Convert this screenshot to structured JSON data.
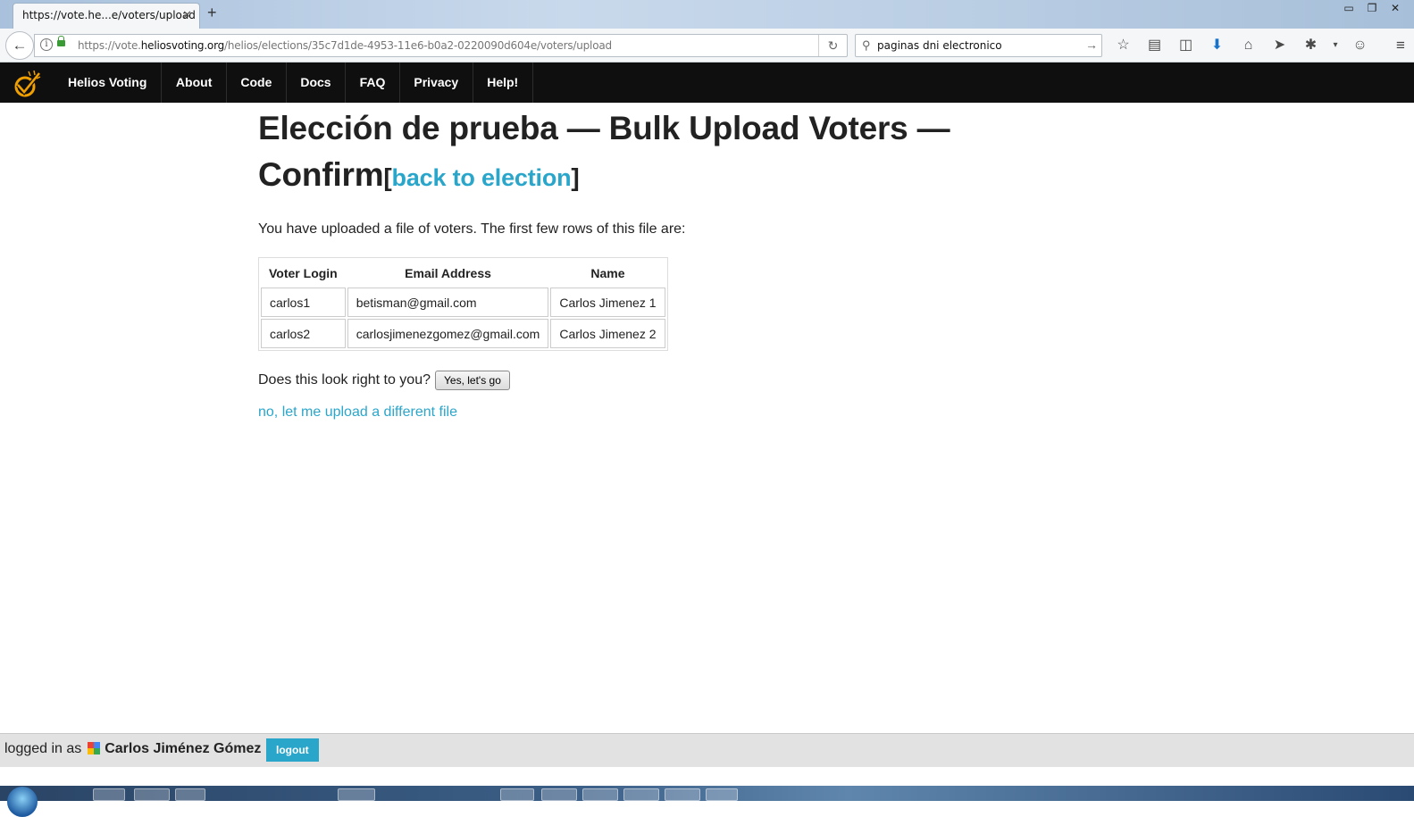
{
  "browser": {
    "tab_title": "https://vote.he...e/voters/upload",
    "tab_close": "✕",
    "new_tab": "+",
    "url_prefix": "https://vote.",
    "url_domain": "heliosvoting.org",
    "url_path": "/helios/elections/35c7d1de-4953-11e6-b0a2-0220090d604e/voters/upload",
    "search_value": "paginas dni electronico",
    "window_buttons": [
      "▭",
      "❐",
      "✕"
    ]
  },
  "nav": {
    "brand": "Helios Voting",
    "items": [
      "About",
      "Code",
      "Docs",
      "FAQ",
      "Privacy",
      "Help!"
    ]
  },
  "page": {
    "title": "Elección de prueba — Bulk Upload Voters — Confirm",
    "back_link_open": "[",
    "back_link": "back to election",
    "back_link_close": "]",
    "intro": "You have uploaded a file of voters. The first few rows of this file are:",
    "table": {
      "headers": [
        "Voter Login",
        "Email Address",
        "Name"
      ],
      "rows": [
        [
          "carlos1",
          "betisman@gmail.com",
          "Carlos Jimenez 1"
        ],
        [
          "carlos2",
          "carlosjimenezgomez@gmail.com",
          "Carlos Jimenez 2"
        ]
      ]
    },
    "confirm_question": "Does this look right to you?",
    "confirm_button": "Yes, let's go",
    "different_file_link": "no, let me upload a different file"
  },
  "footer": {
    "logged_in_prefix": "logged in as",
    "user_name": "Carlos Jiménez Gómez",
    "logout_button": "logout"
  },
  "colors": {
    "accent_link": "#2ba6cb",
    "nav_background": "#0f0f0f",
    "footer_background": "#e2e2e2",
    "logo_orange": "#f0a000"
  }
}
